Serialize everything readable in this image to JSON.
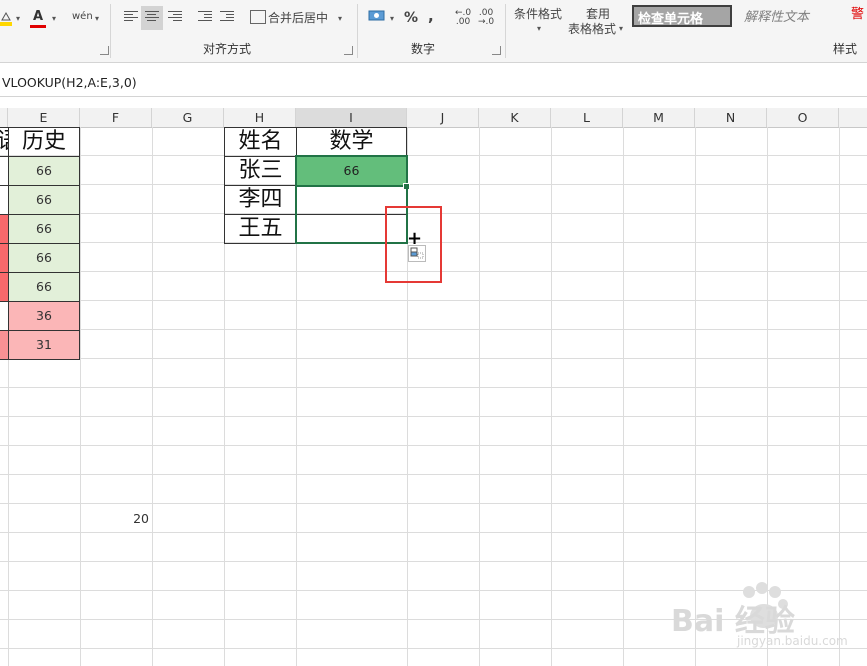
{
  "ribbon": {
    "font_color_icon": "A",
    "phonetic_icon": "wén",
    "merge_center_label": "合并后居中",
    "alignment_group": "对齐方式",
    "percent_symbol": "%",
    "comma_symbol": ",",
    "decimal_increase": "←.0\n.00",
    "decimal_decrease": ".00\n→.0",
    "number_group": "数字",
    "conditional_format_label": "条件格式",
    "table_format_label_1": "套用",
    "table_format_label_2": "表格格式",
    "style_check_cell": "检查单元格",
    "style_explanatory": "解释性文本",
    "style_warning": "警",
    "styles_group": "样式"
  },
  "formula_bar": {
    "formula": "VLOOKUP(H2,A:E,3,0)"
  },
  "columns": [
    "语",
    "E",
    "F",
    "G",
    "H",
    "I",
    "J",
    "K",
    "L",
    "M",
    "N",
    "O"
  ],
  "colors": {
    "selected_fill": "#63be7b",
    "selection_border": "#217346",
    "light_green": "#e2f0d9",
    "red_strong": "#f8696b",
    "red_medium": "#f99194",
    "red_light": "#fbb6b7",
    "callout_red": "#e53935"
  },
  "left_table": {
    "partial_header": "语",
    "header": "历史",
    "values": [
      "66",
      "66",
      "66",
      "66",
      "66",
      "36",
      "31"
    ]
  },
  "lookup_table": {
    "headers": [
      "姓名",
      "数学"
    ],
    "names": [
      "张三",
      "李四",
      "王五"
    ],
    "math": [
      "66",
      "",
      ""
    ]
  },
  "f_cell_value": "20",
  "watermark": {
    "brand": "Bai 经验",
    "url": "jingyan.baidu.com"
  }
}
